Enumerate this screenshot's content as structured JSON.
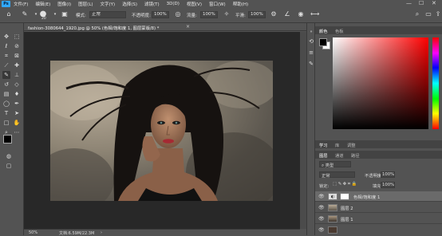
{
  "app": {
    "logo": "Ps"
  },
  "menu": [
    "文件(F)",
    "编辑(E)",
    "图像(I)",
    "图层(L)",
    "文字(Y)",
    "选择(S)",
    "滤镜(T)",
    "3D(D)",
    "视图(V)",
    "窗口(W)",
    "帮助(H)"
  ],
  "window_controls": {
    "minimize": "—",
    "maximize": "☐",
    "close": "✕"
  },
  "options": {
    "brush_size": "20",
    "mode_label": "模式:",
    "mode_value": "正常",
    "opacity_label": "不透明度:",
    "opacity_value": "100%",
    "flow_label": "流量:",
    "flow_value": "100%",
    "smoothing_label": "平滑:",
    "smoothing_value": "100%"
  },
  "document": {
    "tab_title": "fashion-3080644_1920.jpg @ 50% (色相/饱和度 1, 图层蒙版/8) *",
    "close": "×",
    "zoom": "50%",
    "doc_info": "文档:6.59M/22.3M"
  },
  "color_panel": {
    "tabs": [
      "颜色",
      "色板"
    ],
    "foreground": "#000000",
    "background": "#ffffff"
  },
  "learn_panel": {
    "tabs": [
      "学习",
      "库",
      "调整"
    ]
  },
  "layers_panel": {
    "tabs": [
      "图层",
      "通道",
      "路径"
    ],
    "kind_label": "类型",
    "blend_mode": "正常",
    "opacity_label": "不透明度:",
    "opacity_value": "100%",
    "lock_label": "锁定:",
    "fill_label": "填充:",
    "fill_value": "100%",
    "layers": [
      {
        "name": "色相/饱和度 1",
        "selected": true
      },
      {
        "name": "图层 2",
        "selected": false
      },
      {
        "name": "图层 1",
        "selected": false
      },
      {
        "name": "",
        "selected": false
      }
    ]
  },
  "icons": {
    "tools": [
      "move-icon",
      "marquee-icon",
      "lasso-icon",
      "quick-select-icon",
      "crop-icon",
      "frame-icon",
      "eyedropper-icon",
      "spot-heal-icon",
      "brush-icon",
      "stamp-icon",
      "history-brush-icon",
      "eraser-icon",
      "gradient-icon",
      "blur-icon",
      "dodge-icon",
      "pen-icon",
      "type-icon",
      "path-select-icon",
      "rectangle-icon",
      "hand-icon",
      "zoom-icon",
      "more-icon"
    ]
  },
  "colors": {
    "panel_bg": "#535353",
    "canvas_bg": "#282828",
    "accent": "#31a8ff"
  }
}
